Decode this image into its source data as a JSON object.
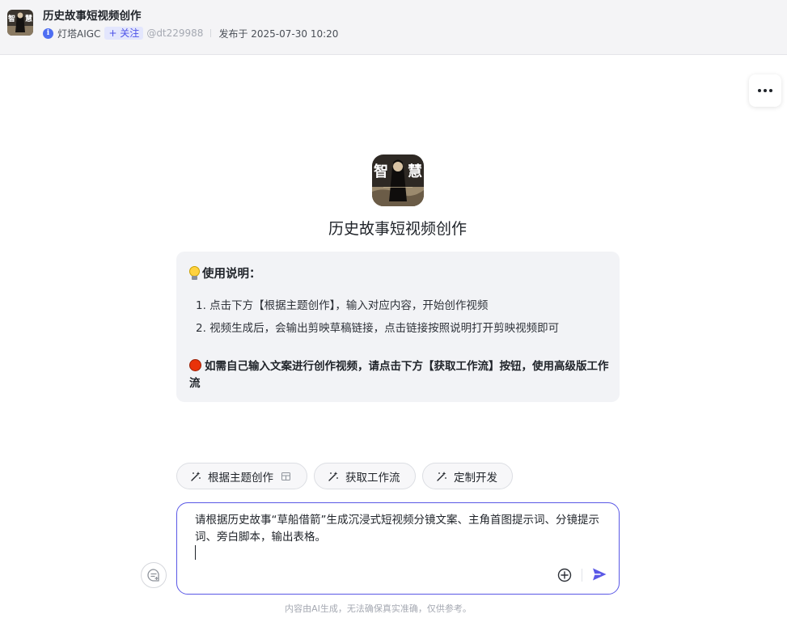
{
  "header": {
    "title": "历史故事短视频创作",
    "author": "灯塔AIGC",
    "follow_label": "+ 关注",
    "handle": "@dt229988",
    "published": "发布于 2025-07-30 10:20"
  },
  "bot": {
    "avatar_text": [
      "智",
      "慧"
    ],
    "name": "历史故事短视频创作"
  },
  "intro": {
    "heading": "使用说明：",
    "steps": [
      "1. 点击下方【根据主题创作】，输入对应内容，开始创作视频",
      "2. 视频生成后，会输出剪映草稿链接，点击链接按照说明打开剪映视频即可"
    ],
    "warning": "如需自己输入文案进行创作视频，请点击下方【获取工作流】按钮，使用高级版工作流"
  },
  "shortcuts": [
    {
      "label": "根据主题创作",
      "icon": "magic-wand-icon"
    },
    {
      "label": "获取工作流",
      "icon": "magic-wand-icon"
    },
    {
      "label": "定制开发",
      "icon": "magic-wand-icon"
    }
  ],
  "composer": {
    "value": "请根据历史故事“草船借箭”生成沉浸式短视频分镜文案、主角首图提示词、分镜提示词、旁白脚本，输出表格。"
  },
  "footer": {
    "disclaimer": "内容由AI生成，无法确保真实准确，仅供参考。"
  },
  "colors": {
    "accent": "#5a58e6",
    "follow_bg": "#e3e6fd",
    "card_bg": "#f2f3f6",
    "warning_dot": "#e9320a"
  }
}
